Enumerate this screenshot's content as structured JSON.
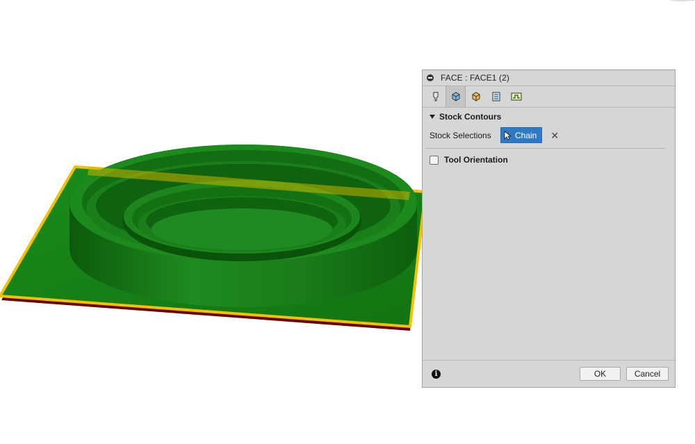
{
  "dialog": {
    "title": "FACE : FACE1 (2)",
    "tabs": [
      {
        "icon": "tool-icon",
        "active": false
      },
      {
        "icon": "geometry-icon",
        "active": true
      },
      {
        "icon": "heights-icon",
        "active": false
      },
      {
        "icon": "passes-icon",
        "active": false
      },
      {
        "icon": "linking-icon",
        "active": false
      }
    ],
    "section_title": "Stock Contours",
    "stock_selections_label": "Stock Selections",
    "chain_label": "Chain",
    "clear_symbol": "✕",
    "tool_orientation_label": "Tool Orientation",
    "info_symbol": "i",
    "ok_label": "OK",
    "cancel_label": "Cancel"
  },
  "colors": {
    "model_green": "#1f8a1f",
    "stock_yellow": "#f2c200",
    "selection_blue": "#2f7ac4",
    "dialog_bg": "#d6d6d6"
  }
}
